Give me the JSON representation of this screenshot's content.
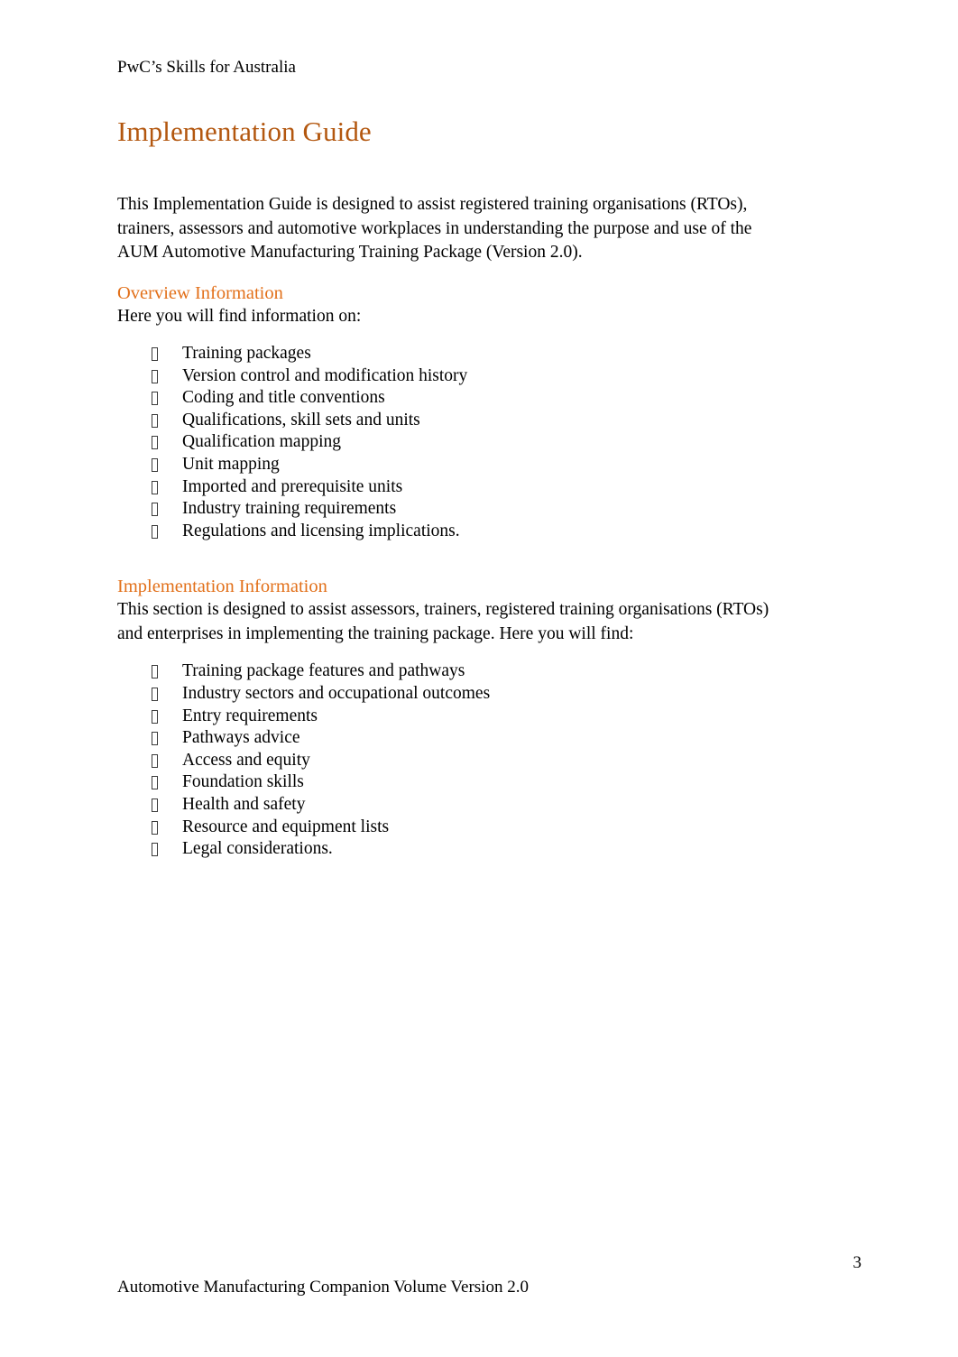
{
  "document": {
    "running_header": "PwC’s Skills for Australia",
    "title": "Implementation Guide",
    "intro_paragraph": "This Implementation Guide is designed to assist registered training organisations (RTOs), trainers, assessors and automotive workplaces in understanding the purpose and use of the AUM Automotive Manufacturing Training Package (Version 2.0).",
    "footer_text": "Automotive Manufacturing Companion Volume Version 2.0",
    "page_number": "3"
  },
  "colors": {
    "title": "#b3570f",
    "section_heading": "#e2701a",
    "body_text": "#000000",
    "page_background": "#ffffff"
  },
  "sections": [
    {
      "heading": "Overview Information",
      "lead": "Here you will find information on:",
      "bullet_icon": "missing-glyph-box-icon",
      "items": [
        "Training packages",
        "Version control and modification history",
        "Coding and title conventions",
        "Qualifications, skill sets and units",
        "Qualification mapping",
        "Unit mapping",
        "Imported and prerequisite units",
        "Industry training requirements",
        "Regulations and licensing implications."
      ]
    },
    {
      "heading": "Implementation Information",
      "lead": "This section is designed to assist assessors, trainers, registered training organisations (RTOs) and enterprises in implementing the training package. Here you will find:",
      "bullet_icon": "missing-glyph-box-icon",
      "items": [
        "Training package features and pathways",
        "Industry sectors and occupational outcomes",
        "Entry requirements",
        "Pathways advice",
        "Access and equity",
        "Foundation skills",
        "Health and safety",
        "Resource and equipment lists",
        "Legal considerations."
      ]
    }
  ]
}
